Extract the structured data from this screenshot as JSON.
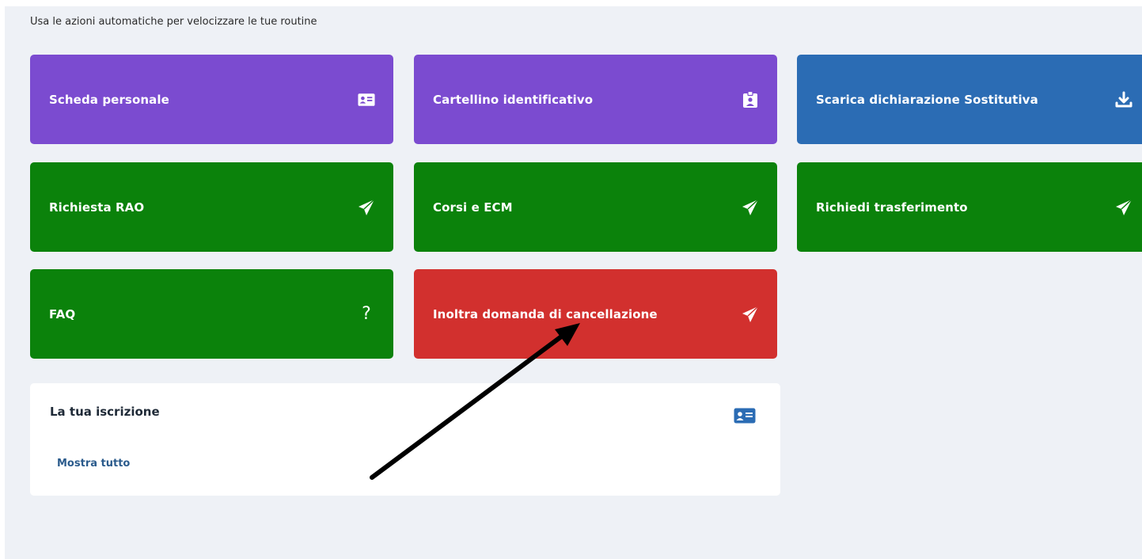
{
  "header": {
    "subtitle": "Usa le azioni automatiche per velocizzare le tue routine"
  },
  "cards": {
    "scheda_personale": {
      "label": "Scheda personale",
      "icon": "id-card-icon",
      "color": "#7b4bd0"
    },
    "cartellino": {
      "label": "Cartellino identificativo",
      "icon": "badge-icon",
      "color": "#7b4bd0"
    },
    "scarica": {
      "label": "Scarica dichiarazione Sostitutiva",
      "icon": "download-icon",
      "color": "#2b6cb4"
    },
    "richiesta_rao": {
      "label": "Richiesta RAO",
      "icon": "send-icon",
      "color": "#0b820b"
    },
    "corsi_ecm": {
      "label": "Corsi e ECM",
      "icon": "send-icon",
      "color": "#0b820b"
    },
    "trasferimento": {
      "label": "Richiedi trasferimento",
      "icon": "send-icon",
      "color": "#0b820b"
    },
    "faq": {
      "label": "FAQ",
      "icon": "question-icon",
      "color": "#0b820b"
    },
    "cancellazione": {
      "label": "Inoltra domanda di cancellazione",
      "icon": "send-icon",
      "color": "#d2302e"
    }
  },
  "subscription": {
    "title": "La tua iscrizione",
    "link": "Mostra tutto",
    "icon": "id-card-icon"
  },
  "annotation": {
    "icon": "arrow-annotation",
    "color": "#000000"
  }
}
